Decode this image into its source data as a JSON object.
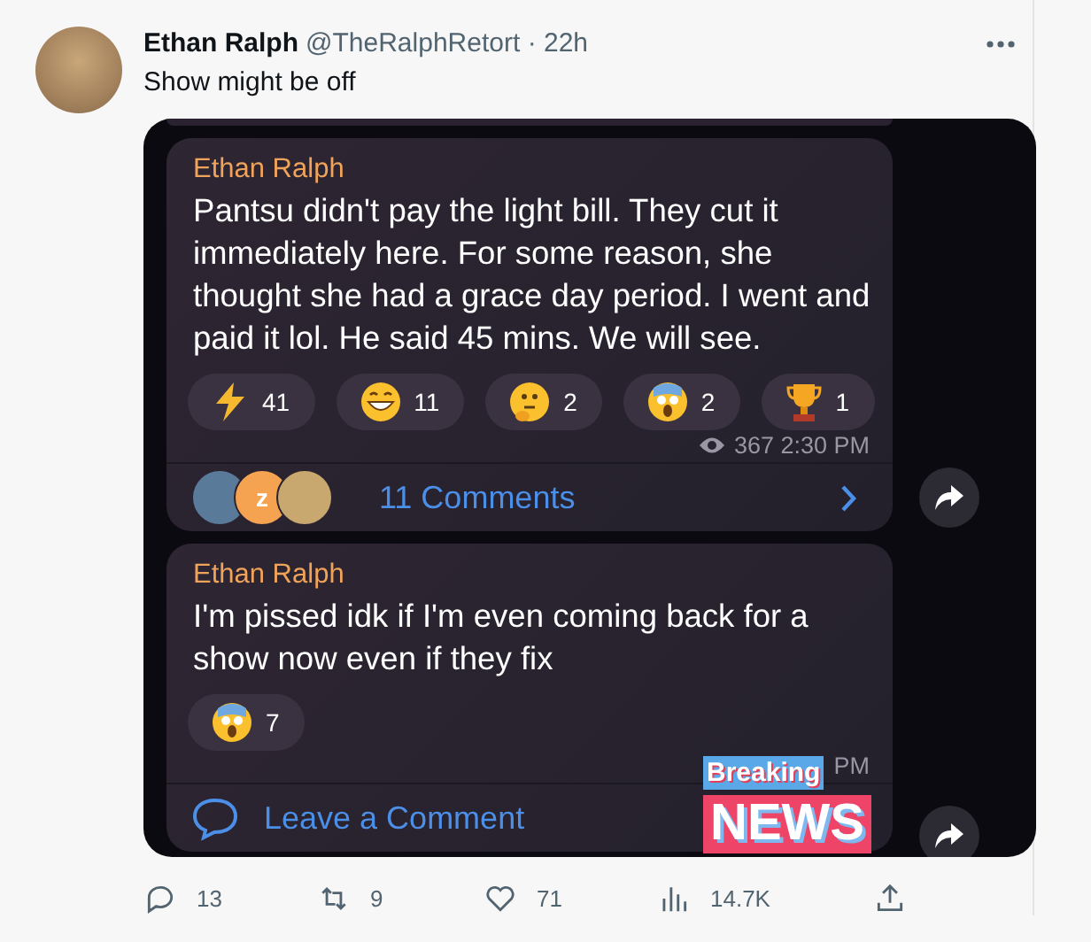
{
  "tweet": {
    "author": "Ethan Ralph",
    "handle": "@TheRalphRetort",
    "time": "· 22h",
    "text": "Show might be off",
    "messages": [
      {
        "sender": "Ethan Ralph",
        "text": "Pantsu didn't pay the light bill. They cut it immediately here. For some reason, she thought she had a grace day period. I went and paid it lol. He said 45 mins. We will see.",
        "reactions": [
          {
            "kind": "lightning",
            "count": "41"
          },
          {
            "kind": "grin",
            "count": "11"
          },
          {
            "kind": "thinking",
            "count": "2"
          },
          {
            "kind": "scream",
            "count": "2"
          },
          {
            "kind": "trophy",
            "count": "1"
          }
        ],
        "views": "367",
        "time": "2:30 PM",
        "footer": {
          "kind": "comments",
          "label": "11 Comments",
          "avatar_letter": "z"
        }
      },
      {
        "sender": "Ethan Ralph",
        "text": "I'm pissed idk if I'm even coming back for a show now even if they fix",
        "reactions": [
          {
            "kind": "scream",
            "count": "7"
          }
        ],
        "time": "PM",
        "footer": {
          "kind": "leave",
          "label": "Leave a Comment"
        }
      }
    ],
    "overlay": {
      "top": "Breaking",
      "bottom": "NEWS"
    },
    "actions": [
      {
        "kind": "reply",
        "count": "13"
      },
      {
        "kind": "retweet",
        "count": "9"
      },
      {
        "kind": "like",
        "count": "71"
      },
      {
        "kind": "views",
        "count": "14.7K"
      },
      {
        "kind": "share"
      }
    ]
  }
}
